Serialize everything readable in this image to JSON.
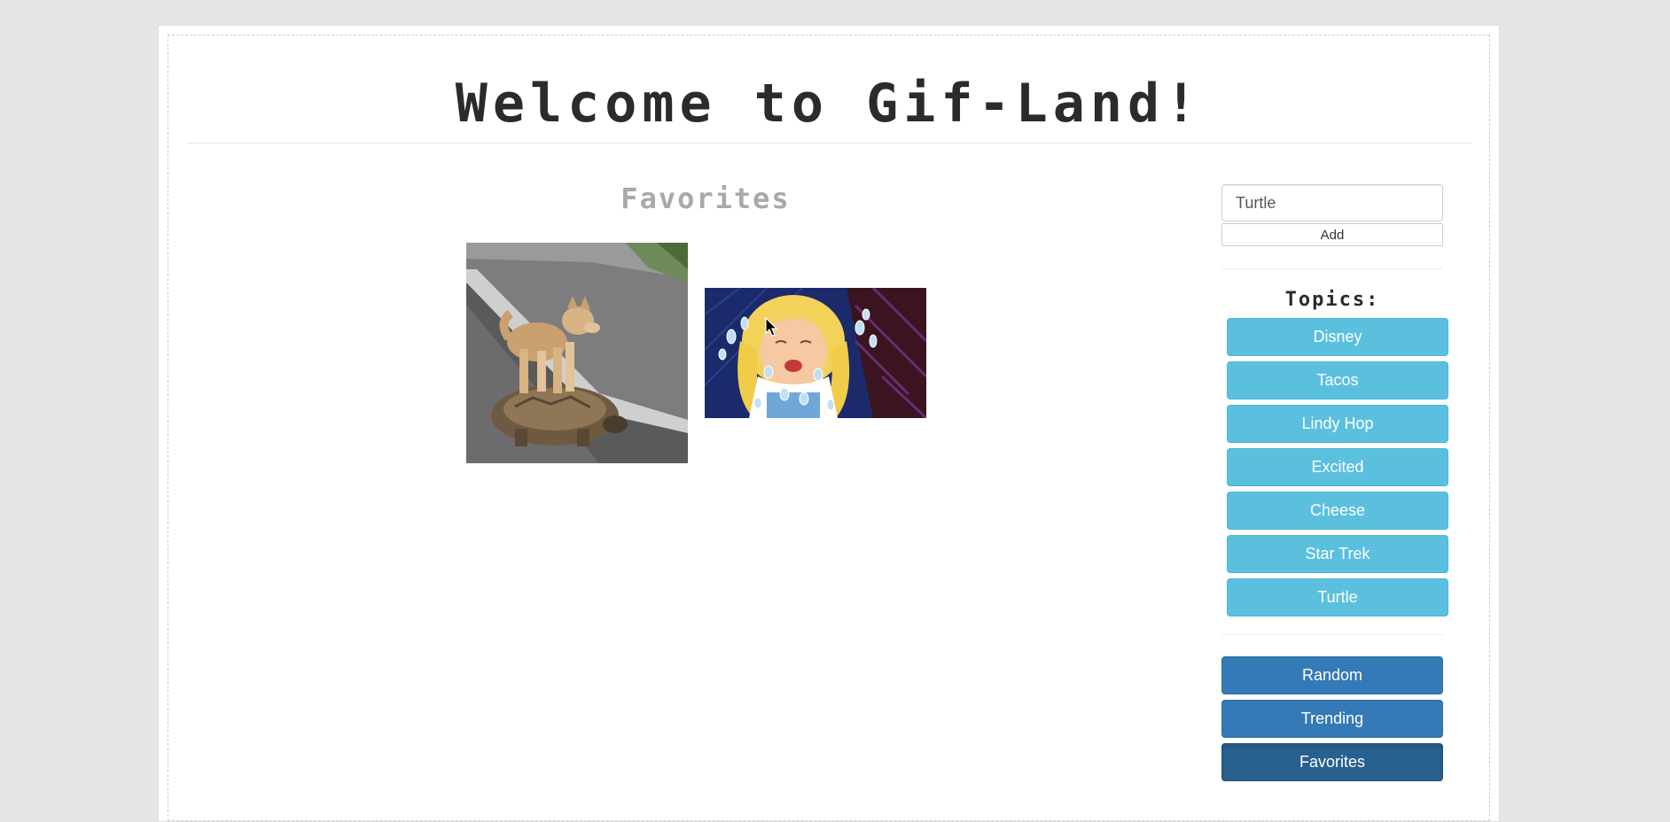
{
  "header": {
    "title": "Welcome to Gif-Land!"
  },
  "main": {
    "section_title": "Favorites",
    "gifs": [
      {
        "icon": "dog-on-turtle-gif"
      },
      {
        "icon": "crying-alice-gif"
      }
    ]
  },
  "sidebar": {
    "search": {
      "value": "Turtle"
    },
    "add_label": "Add",
    "topics_heading": "Topics:",
    "topics": [
      "Disney",
      "Tacos",
      "Lindy Hop",
      "Excited",
      "Cheese",
      "Star Trek",
      "Turtle"
    ],
    "nav": {
      "random": "Random",
      "trending": "Trending",
      "favorites": "Favorites"
    }
  },
  "colors": {
    "topic_button": "#5bc0de",
    "nav_button": "#337ab7",
    "nav_active": "#286090",
    "page_bg": "#e6e6e6"
  }
}
